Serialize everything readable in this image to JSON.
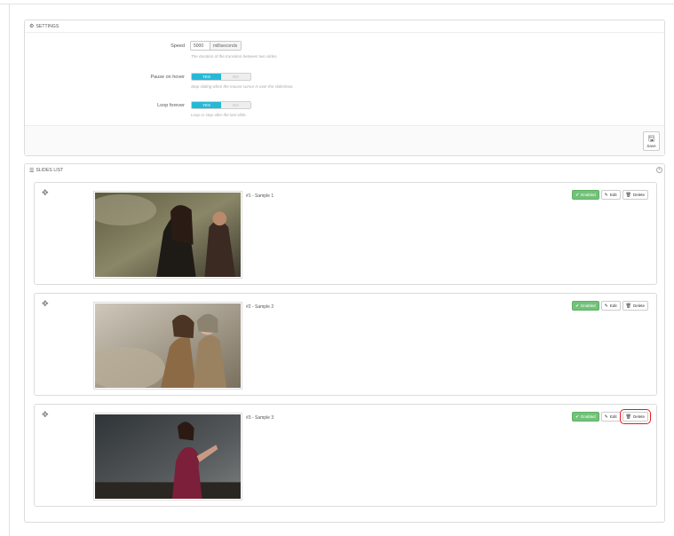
{
  "settings": {
    "title": "SETTINGS",
    "speed": {
      "label": "Speed",
      "value": "5000",
      "unit": "milliseconds",
      "help": "The duration of the transition between two slides."
    },
    "pause": {
      "label": "Pause on hover",
      "yes": "YES",
      "no": "NO",
      "help": "Stop sliding when the mouse cursor is over the slideshow."
    },
    "loop": {
      "label": "Loop forever",
      "yes": "YES",
      "no": "NO",
      "help": "Loop or stop after the last slide."
    },
    "save_label": "Save"
  },
  "slides_list": {
    "title": "SLIDES LIST",
    "slides": [
      {
        "title": "#1 - Sample 1",
        "status": "Enabled",
        "edit": "Edit",
        "delete": "Delete"
      },
      {
        "title": "#2 - Sample 2",
        "status": "Enabled",
        "edit": "Edit",
        "delete": "Delete"
      },
      {
        "title": "#3 - Sample 3",
        "status": "Enabled",
        "edit": "Edit",
        "delete": "Delete"
      }
    ]
  },
  "colors": {
    "accent": "#25b9d7",
    "enabled": "#72c279",
    "highlight": "#e41b23"
  }
}
